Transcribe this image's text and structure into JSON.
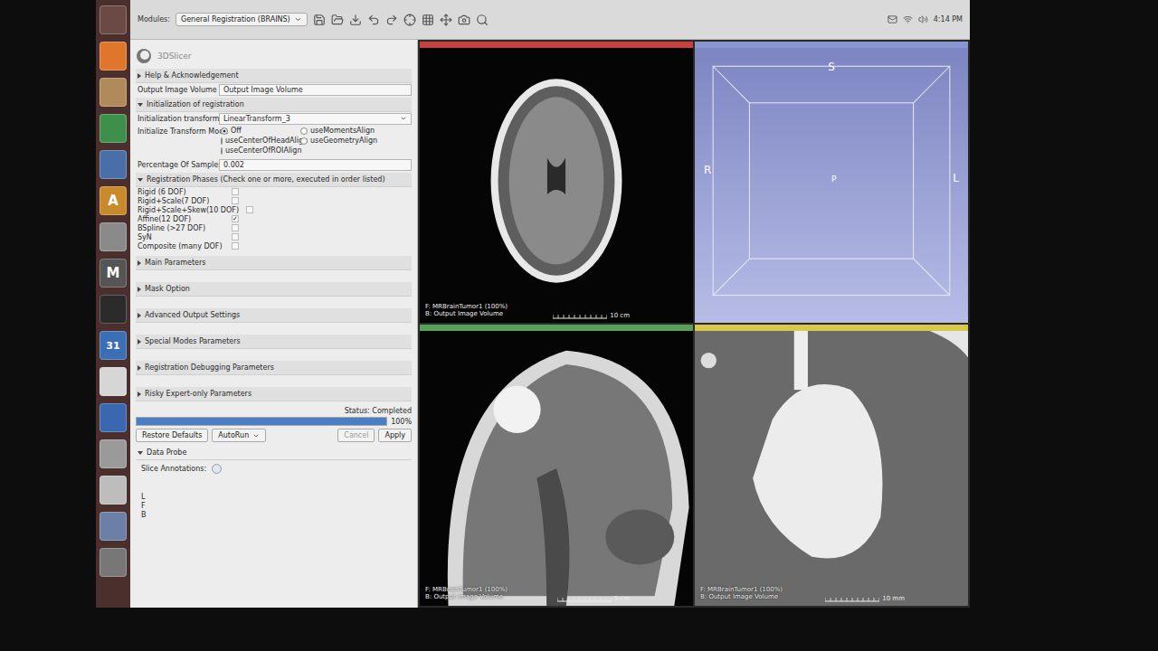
{
  "toolbar": {
    "modules_label": "Modules:",
    "module": "General Registration (BRAINS)",
    "clock": "4:14 PM"
  },
  "launcher": [
    {
      "kind": "dash"
    },
    {
      "kind": "browser"
    },
    {
      "kind": "files"
    },
    {
      "kind": "sheet"
    },
    {
      "kind": "doc"
    },
    {
      "kind": "font",
      "label": "A"
    },
    {
      "kind": "settings"
    },
    {
      "kind": "mail",
      "label": "M"
    },
    {
      "kind": "terminal"
    },
    {
      "kind": "calendar",
      "label": "31"
    },
    {
      "kind": "editor"
    },
    {
      "kind": "writer"
    },
    {
      "kind": "disk"
    },
    {
      "kind": "wifi"
    },
    {
      "kind": "slicer"
    },
    {
      "kind": "trash"
    }
  ],
  "module_panel": {
    "logo": "3DSlicer",
    "help": {
      "title": "Help & Acknowledgement",
      "expanded": false
    },
    "output_volume": {
      "label": "Output Image Volume",
      "value": "Output Image Volume"
    },
    "init_section": {
      "title": "Initialization of registration",
      "expanded": true
    },
    "init_transform": {
      "label": "Initialization transform",
      "value": "LinearTransform_3"
    },
    "init_mode": {
      "label": "Initialize Transform Mode",
      "options": [
        {
          "label": "Off",
          "selected": true
        },
        {
          "label": "useMomentsAlign",
          "selected": false
        },
        {
          "label": "useCenterOfHeadAlign",
          "selected": false
        },
        {
          "label": "useGeometryAlign",
          "selected": false
        },
        {
          "label": "useCenterOfROIAlign",
          "selected": false
        }
      ]
    },
    "samples": {
      "label": "Percentage Of Samples",
      "value": "0.002"
    },
    "phases": {
      "title": "Registration Phases (Check one or more, executed in order listed)",
      "expanded": true,
      "items": [
        {
          "label": "Rigid (6 DOF)",
          "checked": false
        },
        {
          "label": "Rigid+Scale(7 DOF)",
          "checked": false
        },
        {
          "label": "Rigid+Scale+Skew(10 DOF)",
          "checked": false
        },
        {
          "label": "Affine(12 DOF)",
          "checked": true
        },
        {
          "label": "BSpline (>27 DOF)",
          "checked": false
        },
        {
          "label": "SyN",
          "checked": false
        },
        {
          "label": "Composite (many DOF)",
          "checked": false
        }
      ]
    },
    "sections": [
      {
        "title": "Main Parameters",
        "expanded": false
      },
      {
        "title": "Mask Option",
        "expanded": false
      },
      {
        "title": "Advanced Output Settings",
        "expanded": false
      },
      {
        "title": "Special Modes Parameters",
        "expanded": false
      },
      {
        "title": "Registration Debugging Parameters",
        "expanded": false
      },
      {
        "title": "Risky Expert-only Parameters",
        "expanded": false
      }
    ],
    "status": "Status: Completed",
    "progress": {
      "level": 1,
      "reading": "100%"
    },
    "buttons": [
      {
        "label": "Restore Defaults",
        "kind": "plain",
        "disabled": false
      },
      {
        "label": "AutoRun",
        "kind": "split",
        "disabled": false
      },
      {
        "label": "Cancel",
        "kind": "plain",
        "disabled": true
      },
      {
        "label": "Apply",
        "kind": "plain",
        "disabled": false
      }
    ],
    "data_probe": {
      "title": "Data Probe",
      "expanded": true,
      "annotations_label": "Slice Annotations:",
      "axes": [
        "L",
        "F",
        "B"
      ]
    }
  },
  "views": [
    {
      "kind": "axial",
      "color": "#c94040",
      "labels": [
        "F: MRBrainTumor1 (100%)",
        "B: Output Image Volume"
      ],
      "scale": "10 cm"
    },
    {
      "kind": "render3d",
      "color": "#8a96d0",
      "axes": {
        "top": "S",
        "left": "R",
        "right": "L",
        "center": "P"
      }
    },
    {
      "kind": "sagittal",
      "color": "#58a058",
      "labels": [
        "F: MRBrainTumor1 (100%)",
        "B: Output Image Volume"
      ],
      "scale": "5 cm"
    },
    {
      "kind": "zoom",
      "color": "#d9c84a",
      "labels": [
        "F: MRBrainTumor1 (100%)",
        "B: Output Image Volume"
      ],
      "scale": "10 mm"
    }
  ]
}
